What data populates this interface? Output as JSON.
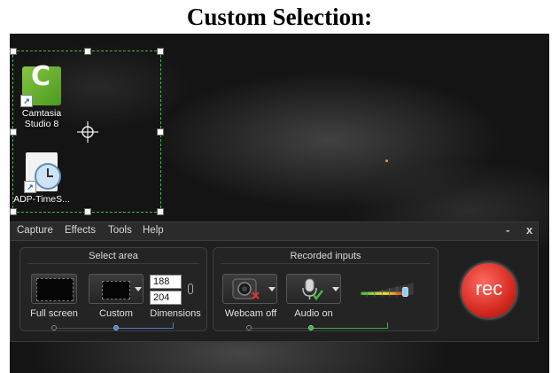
{
  "heading": "Custom Selection:",
  "desktop": {
    "icons": [
      {
        "label_line1": "Camtasia",
        "label_line2": "Studio 8",
        "icon": "camtasia-icon"
      },
      {
        "label_line1": "ADP-TimeS...",
        "label_line2": "",
        "icon": "clock-document-icon"
      }
    ]
  },
  "recorder": {
    "menu": [
      "Capture",
      "Effects",
      "Tools",
      "Help"
    ],
    "window_buttons": {
      "minimize": "-",
      "close": "x"
    },
    "select_area": {
      "title": "Select area",
      "full_screen_label": "Full screen",
      "custom_label": "Custom",
      "dimensions_label": "Dimensions",
      "width": "188",
      "height": "204"
    },
    "recorded_inputs": {
      "title": "Recorded inputs",
      "webcam_label": "Webcam off",
      "audio_label": "Audio on",
      "audio_level": 0.85
    },
    "rec_label": "rec"
  },
  "colors": {
    "selection": "#3bbf3b",
    "rec": "#d42a20",
    "accent_blue": "#4a7cc7",
    "accent_green": "#3fae3f"
  }
}
